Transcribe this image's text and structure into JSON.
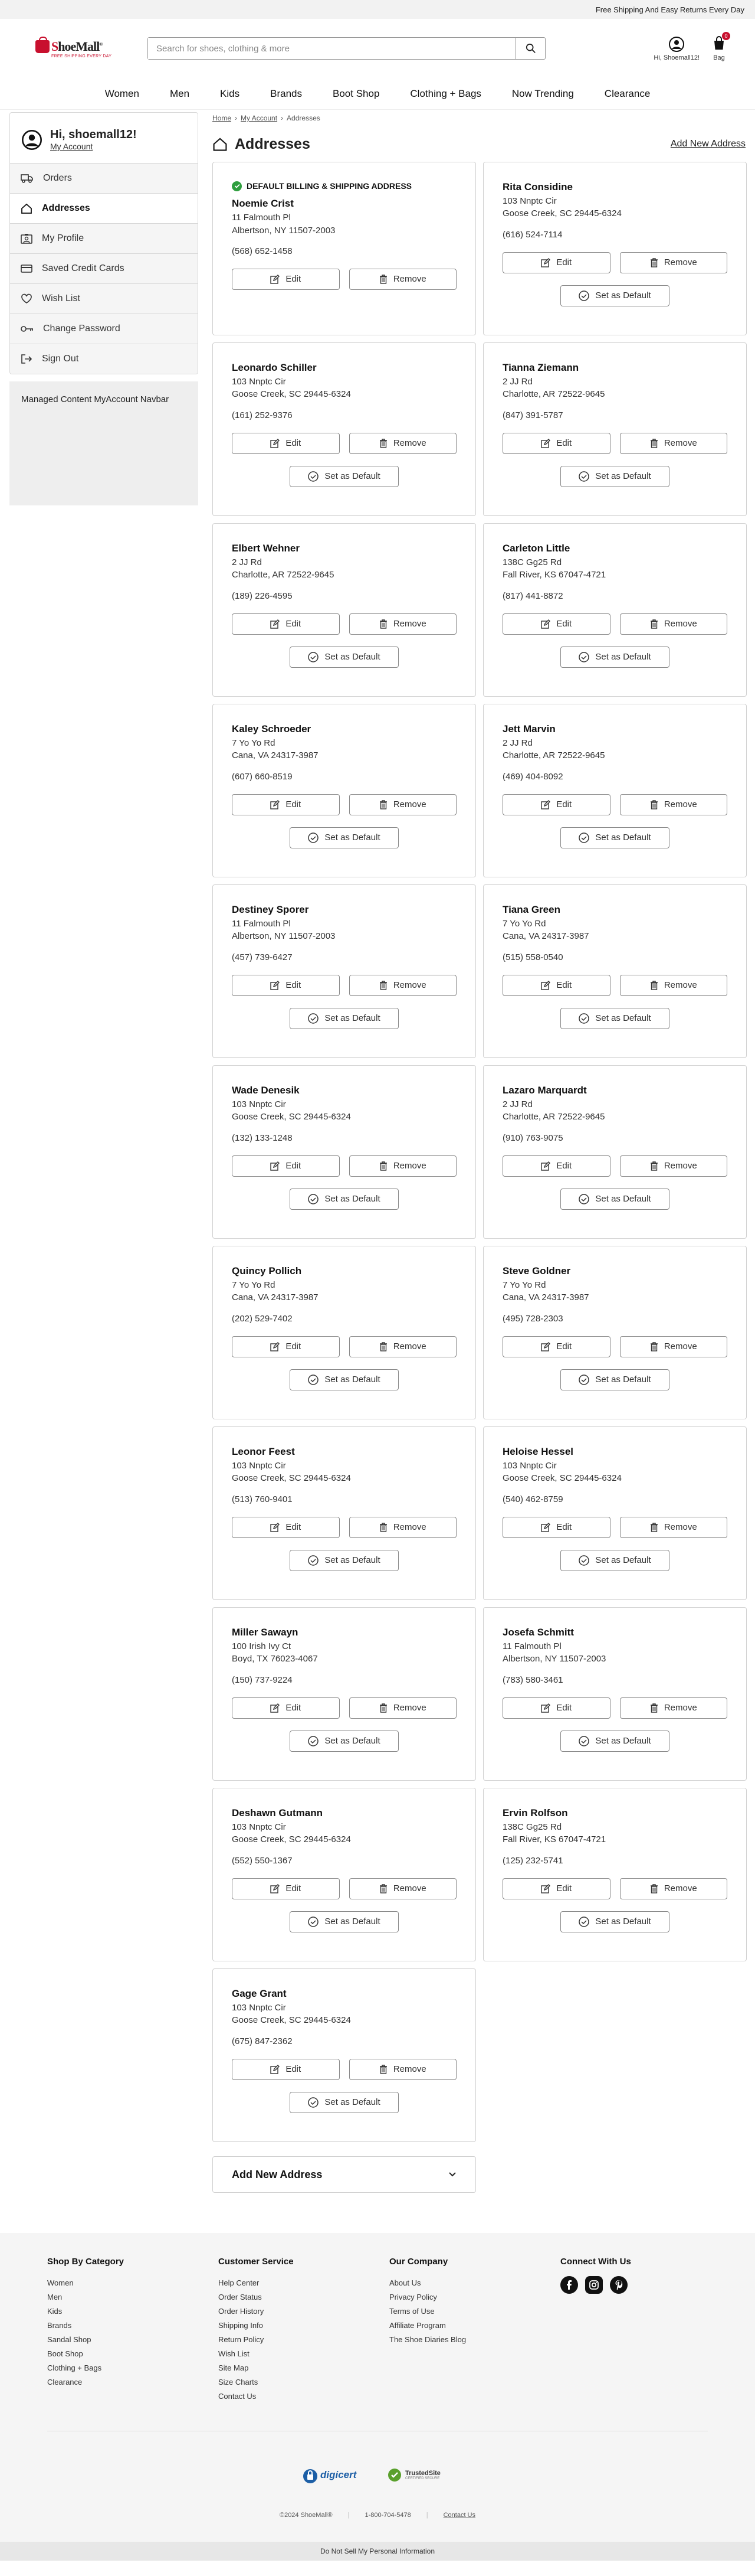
{
  "topbar": {
    "promo": "Free Shipping And Easy Returns Every Day"
  },
  "logo": {
    "brand_prefix": "S",
    "brand_rest": "hoeMall",
    "tagline": "FREE SHIPPING EVERY DAY",
    "trademark": "®"
  },
  "search": {
    "placeholder": "Search for shoes, clothing & more"
  },
  "header": {
    "account_label": "Hi, Shoemall12!",
    "bag_label": "Bag",
    "bag_count": "0"
  },
  "nav": [
    "Women",
    "Men",
    "Kids",
    "Brands",
    "Boot Shop",
    "Clothing + Bags",
    "Now Trending",
    "Clearance"
  ],
  "sidebar": {
    "greeting": "Hi, shoemall12!",
    "my_account": "My Account",
    "items": [
      {
        "label": "Orders",
        "icon": "truck-icon"
      },
      {
        "label": "Addresses",
        "icon": "home-icon",
        "active": true
      },
      {
        "label": "My Profile",
        "icon": "profile-icon"
      },
      {
        "label": "Saved Credit Cards",
        "icon": "credit-card-icon"
      },
      {
        "label": "Wish List",
        "icon": "heart-icon"
      },
      {
        "label": "Change Password",
        "icon": "key-icon"
      },
      {
        "label": "Sign Out",
        "icon": "sign-out-icon"
      }
    ],
    "managed_content": "Managed Content MyAccount Navbar"
  },
  "breadcrumb": [
    "Home",
    "My Account",
    "Addresses"
  ],
  "page": {
    "title": "Addresses",
    "add_new_link": "Add New Address"
  },
  "labels": {
    "default_badge": "DEFAULT BILLING & SHIPPING ADDRESS",
    "edit": "Edit",
    "remove": "Remove",
    "set_default": "Set as Default"
  },
  "addresses": [
    {
      "name": "Noemie Crist",
      "street": "11 Falmouth Pl",
      "city": "Albertson, NY 11507-2003",
      "phone": "(568) 652-1458",
      "is_default": true
    },
    {
      "name": "Rita Considine",
      "street": "103 Nnptc Cir",
      "city": "Goose Creek, SC 29445-6324",
      "phone": "(616) 524-7114"
    },
    {
      "name": "Leonardo Schiller",
      "street": "103 Nnptc Cir",
      "city": "Goose Creek, SC 29445-6324",
      "phone": "(161) 252-9376"
    },
    {
      "name": "Tianna Ziemann",
      "street": "2 JJ Rd",
      "city": "Charlotte, AR 72522-9645",
      "phone": "(847) 391-5787"
    },
    {
      "name": "Elbert Wehner",
      "street": "2 JJ Rd",
      "city": "Charlotte, AR 72522-9645",
      "phone": "(189) 226-4595"
    },
    {
      "name": "Carleton Little",
      "street": "138C Gg25 Rd",
      "city": "Fall River, KS 67047-4721",
      "phone": "(817) 441-8872"
    },
    {
      "name": "Kaley Schroeder",
      "street": "7 Yo Yo Rd",
      "city": "Cana, VA 24317-3987",
      "phone": "(607) 660-8519"
    },
    {
      "name": "Jett Marvin",
      "street": "2 JJ Rd",
      "city": "Charlotte, AR 72522-9645",
      "phone": "(469) 404-8092"
    },
    {
      "name": "Destiney Sporer",
      "street": "11 Falmouth Pl",
      "city": "Albertson, NY 11507-2003",
      "phone": "(457) 739-6427"
    },
    {
      "name": "Tiana Green",
      "street": "7 Yo Yo Rd",
      "city": "Cana, VA 24317-3987",
      "phone": "(515) 558-0540"
    },
    {
      "name": "Wade Denesik",
      "street": "103 Nnptc Cir",
      "city": "Goose Creek, SC 29445-6324",
      "phone": "(132) 133-1248"
    },
    {
      "name": "Lazaro Marquardt",
      "street": "2 JJ Rd",
      "city": "Charlotte, AR 72522-9645",
      "phone": "(910) 763-9075"
    },
    {
      "name": "Quincy Pollich",
      "street": "7 Yo Yo Rd",
      "city": "Cana, VA 24317-3987",
      "phone": "(202) 529-7402"
    },
    {
      "name": "Steve Goldner",
      "street": "7 Yo Yo Rd",
      "city": "Cana, VA 24317-3987",
      "phone": "(495) 728-2303"
    },
    {
      "name": "Leonor Feest",
      "street": "103 Nnptc Cir",
      "city": "Goose Creek, SC 29445-6324",
      "phone": "(513) 760-9401"
    },
    {
      "name": "Heloise Hessel",
      "street": "103 Nnptc Cir",
      "city": "Goose Creek, SC 29445-6324",
      "phone": "(540) 462-8759"
    },
    {
      "name": "Miller Sawayn",
      "street": "100 Irish Ivy Ct",
      "city": "Boyd, TX 76023-4067",
      "phone": "(150) 737-9224"
    },
    {
      "name": "Josefa Schmitt",
      "street": "11 Falmouth Pl",
      "city": "Albertson, NY 11507-2003",
      "phone": "(783) 580-3461"
    },
    {
      "name": "Deshawn Gutmann",
      "street": "103 Nnptc Cir",
      "city": "Goose Creek, SC 29445-6324",
      "phone": "(552) 550-1367"
    },
    {
      "name": "Ervin Rolfson",
      "street": "138C Gg25 Rd",
      "city": "Fall River, KS 67047-4721",
      "phone": "(125) 232-5741"
    },
    {
      "name": "Gage Grant",
      "street": "103 Nnptc Cir",
      "city": "Goose Creek, SC 29445-6324",
      "phone": "(675) 847-2362"
    }
  ],
  "add_new_section": {
    "label": "Add New Address"
  },
  "footer": {
    "columns": [
      {
        "heading": "Shop By Category",
        "links": [
          "Women",
          "Men",
          "Kids",
          "Brands",
          "Sandal Shop",
          "Boot Shop",
          "Clothing + Bags",
          "Clearance"
        ]
      },
      {
        "heading": "Customer Service",
        "links": [
          "Help Center",
          "Order Status",
          "Order History",
          "Shipping Info",
          "Return Policy",
          "Wish List",
          "Site Map",
          "Size Charts",
          "Contact Us"
        ]
      },
      {
        "heading": "Our Company",
        "links": [
          "About Us",
          "Privacy Policy",
          "Terms of Use",
          "Affiliate Program",
          "The Shoe Diaries Blog"
        ]
      }
    ],
    "connect_heading": "Connect With Us",
    "social": [
      {
        "icon": "facebook-icon"
      },
      {
        "icon": "instagram-icon"
      },
      {
        "icon": "pinterest-icon"
      }
    ],
    "digicert_label": "digicert",
    "trustedsite_label": "TrustedSite",
    "trustedsite_sub": "CERTIFIED SECURE",
    "copyright": "©2024 ShoeMall®",
    "phone": "1-800-704-5478",
    "contact_us": "Contact Us",
    "do_not_sell": "Do Not Sell My Personal Information"
  },
  "colors": {
    "brand_red": "#c8102e",
    "success_green": "#2e9e3e"
  }
}
